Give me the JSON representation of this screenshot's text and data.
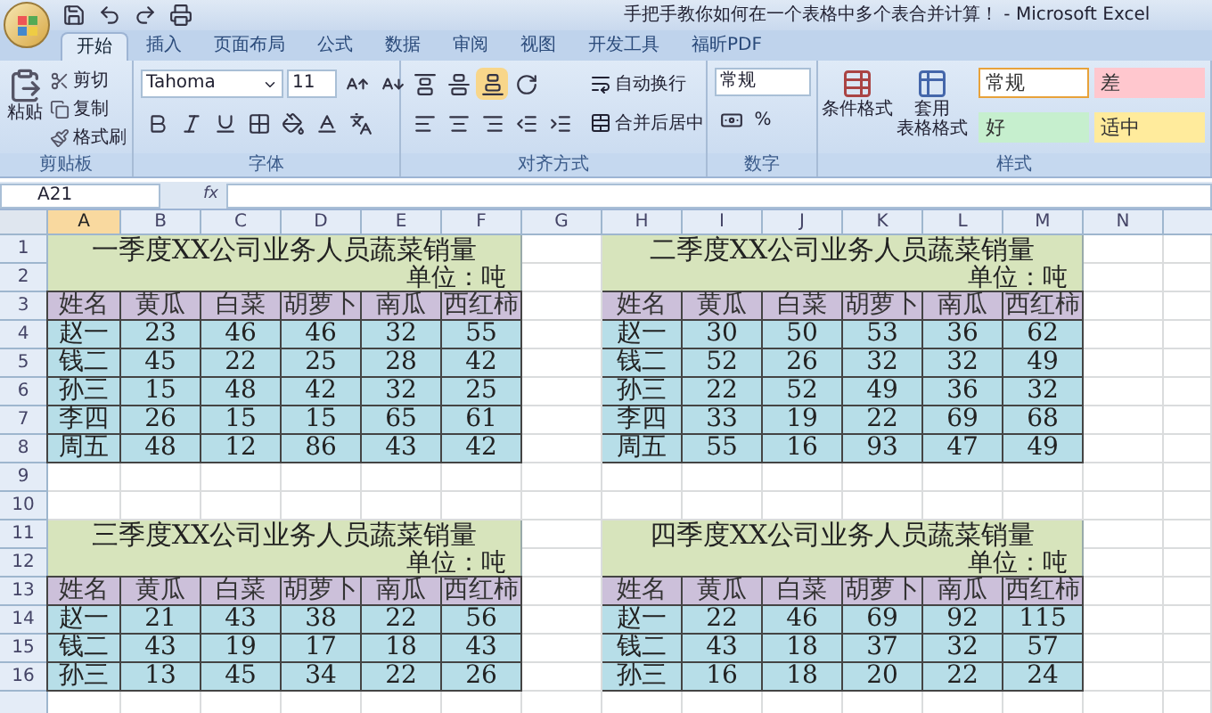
{
  "window": {
    "title": "手把手教你如何在一个表格中多个表合并计算！ - Microsoft Excel"
  },
  "ribbon_tabs": [
    {
      "label": "开始",
      "selected": true
    },
    {
      "label": "插入",
      "selected": false
    },
    {
      "label": "页面布局",
      "selected": false
    },
    {
      "label": "公式",
      "selected": false
    },
    {
      "label": "数据",
      "selected": false
    },
    {
      "label": "审阅",
      "selected": false
    },
    {
      "label": "视图",
      "selected": false
    },
    {
      "label": "开发工具",
      "selected": false
    },
    {
      "label": "福昕PDF",
      "selected": false
    }
  ],
  "clipboard": {
    "paste": "粘贴",
    "cut": "剪切",
    "copy": "复制",
    "format_painter": "格式刷",
    "label": "剪贴板"
  },
  "font": {
    "name": "Tahoma",
    "size": "11",
    "label": "字体"
  },
  "alignment": {
    "wrap": "自动换行",
    "merge": "合并后居中",
    "label": "对齐方式"
  },
  "number": {
    "format": "常规",
    "percent": "%",
    "label": "数字"
  },
  "styles": {
    "conditional": "条件格式",
    "table_format": [
      "套用",
      "表格格式"
    ],
    "label": "样式",
    "cell_styles": [
      {
        "label": "常规",
        "color": "#ffffff",
        "selected": true
      },
      {
        "label": "差",
        "color": "#ffc7ce",
        "selected": false
      },
      {
        "label": "好",
        "color": "#c6efce",
        "selected": false
      },
      {
        "label": "适中",
        "color": "#ffeb9c",
        "selected": false
      }
    ]
  },
  "formula_bar": {
    "name_box": "A21",
    "fx": "fx"
  },
  "columns": [
    {
      "label": "A",
      "selected": true
    },
    {
      "label": "B",
      "selected": false
    },
    {
      "label": "C",
      "selected": false
    },
    {
      "label": "D",
      "selected": false
    },
    {
      "label": "E",
      "selected": false
    },
    {
      "label": "F",
      "selected": false
    },
    {
      "label": "G",
      "selected": false
    },
    {
      "label": "H",
      "selected": false
    },
    {
      "label": "I",
      "selected": false
    },
    {
      "label": "J",
      "selected": false
    },
    {
      "label": "K",
      "selected": false
    },
    {
      "label": "L",
      "selected": false
    },
    {
      "label": "M",
      "selected": false
    },
    {
      "label": "N",
      "selected": false
    }
  ],
  "rows": [
    "1",
    "2",
    "3",
    "4",
    "5",
    "6",
    "7",
    "8",
    "9",
    "10",
    "11",
    "12",
    "13",
    "14",
    "15",
    "16"
  ],
  "tables": [
    {
      "title": "一季度XX公司业务人员蔬菜销量",
      "unit": "单位：吨",
      "headers": [
        "姓名",
        "黄瓜",
        "白菜",
        "胡萝卜",
        "南瓜",
        "西红柿"
      ],
      "rows": [
        [
          "赵一",
          "23",
          "46",
          "46",
          "32",
          "55"
        ],
        [
          "钱二",
          "45",
          "22",
          "25",
          "28",
          "42"
        ],
        [
          "孙三",
          "15",
          "48",
          "42",
          "32",
          "25"
        ],
        [
          "李四",
          "26",
          "15",
          "15",
          "65",
          "61"
        ],
        [
          "周五",
          "48",
          "12",
          "86",
          "43",
          "42"
        ]
      ]
    },
    {
      "title": "二季度XX公司业务人员蔬菜销量",
      "unit": "单位：吨",
      "headers": [
        "姓名",
        "黄瓜",
        "白菜",
        "胡萝卜",
        "南瓜",
        "西红柿"
      ],
      "rows": [
        [
          "赵一",
          "30",
          "50",
          "53",
          "36",
          "62"
        ],
        [
          "钱二",
          "52",
          "26",
          "32",
          "32",
          "49"
        ],
        [
          "孙三",
          "22",
          "52",
          "49",
          "36",
          "32"
        ],
        [
          "李四",
          "33",
          "19",
          "22",
          "69",
          "68"
        ],
        [
          "周五",
          "55",
          "16",
          "93",
          "47",
          "49"
        ]
      ]
    },
    {
      "title": "三季度XX公司业务人员蔬菜销量",
      "unit": "单位：吨",
      "headers": [
        "姓名",
        "黄瓜",
        "白菜",
        "胡萝卜",
        "南瓜",
        "西红柿"
      ],
      "rows": [
        [
          "赵一",
          "21",
          "43",
          "38",
          "22",
          "56"
        ],
        [
          "钱二",
          "43",
          "19",
          "17",
          "18",
          "43"
        ],
        [
          "孙三",
          "13",
          "45",
          "34",
          "22",
          "26"
        ]
      ]
    },
    {
      "title": "四季度XX公司业务人员蔬菜销量",
      "unit": "单位：吨",
      "headers": [
        "姓名",
        "黄瓜",
        "白菜",
        "胡萝卜",
        "南瓜",
        "西红柿"
      ],
      "rows": [
        [
          "赵一",
          "22",
          "46",
          "69",
          "92",
          "115"
        ],
        [
          "钱二",
          "43",
          "18",
          "37",
          "32",
          "57"
        ],
        [
          "孙三",
          "16",
          "18",
          "20",
          "22",
          "24"
        ]
      ]
    }
  ]
}
